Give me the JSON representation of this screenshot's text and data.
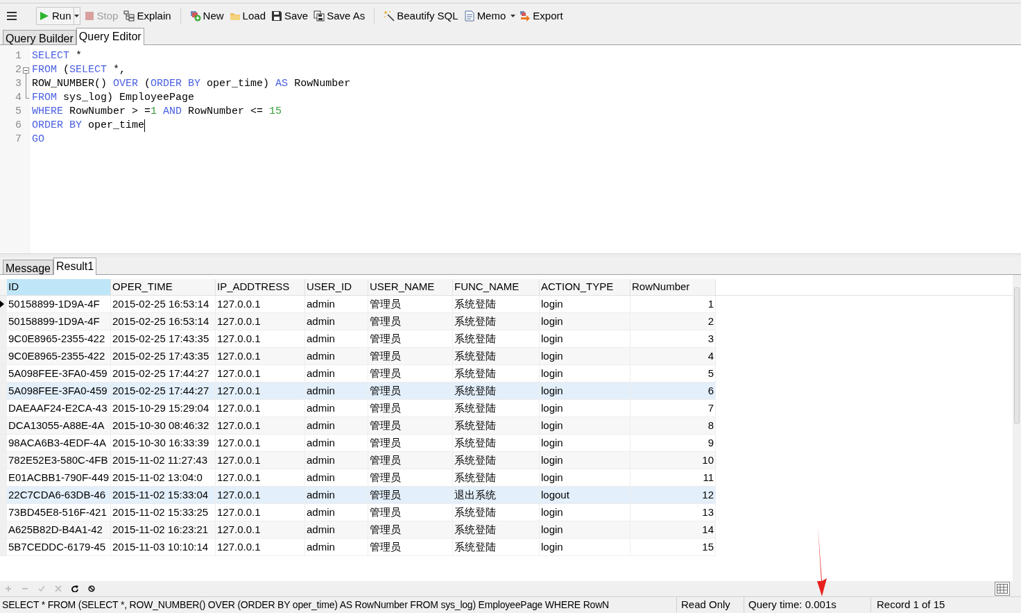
{
  "toolbar": {
    "items": [
      {
        "kind": "run",
        "label": "Run",
        "disabled": false,
        "dropdown": true
      },
      {
        "kind": "stop",
        "label": "Stop",
        "disabled": true,
        "dropdown": false
      },
      {
        "kind": "explain",
        "label": "Explain",
        "disabled": false,
        "dropdown": false
      },
      {
        "kind": "new",
        "label": "New",
        "disabled": false,
        "dropdown": false
      },
      {
        "kind": "load",
        "label": "Load",
        "disabled": false,
        "dropdown": false
      },
      {
        "kind": "save",
        "label": "Save",
        "disabled": false,
        "dropdown": false
      },
      {
        "kind": "saveas",
        "label": "Save As",
        "disabled": false,
        "dropdown": false
      },
      {
        "kind": "beautify",
        "label": "Beautify SQL",
        "disabled": false,
        "dropdown": false
      },
      {
        "kind": "memo",
        "label": "Memo",
        "disabled": false,
        "dropdown": true
      },
      {
        "kind": "export",
        "label": "Export",
        "disabled": false,
        "dropdown": false
      }
    ]
  },
  "editor_tabs": [
    {
      "label": "Query Builder",
      "selected": false
    },
    {
      "label": "Query Editor",
      "selected": true
    }
  ],
  "editor": {
    "lines": [
      {
        "number": "1",
        "kind": "plain",
        "tokens": [
          {
            "text": "SELECT",
            "kind": "keyword"
          },
          {
            "text": " *",
            "kind": "plain"
          }
        ]
      },
      {
        "number": "2",
        "kind": "fold-start",
        "tokens": [
          {
            "text": "FROM",
            "kind": "keyword"
          },
          {
            "text": " (",
            "kind": "plain"
          },
          {
            "text": "SELECT",
            "kind": "keyword"
          },
          {
            "text": " *,",
            "kind": "plain"
          }
        ]
      },
      {
        "number": "3",
        "kind": "fold-inner",
        "tokens": [
          {
            "text": "ROW_NUMBER() ",
            "kind": "plain"
          },
          {
            "text": "OVER",
            "kind": "keyword"
          },
          {
            "text": " (",
            "kind": "plain"
          },
          {
            "text": "ORDER BY",
            "kind": "keyword"
          },
          {
            "text": " oper_time) ",
            "kind": "plain"
          },
          {
            "text": "AS",
            "kind": "keyword"
          },
          {
            "text": " RowNumber",
            "kind": "plain"
          }
        ]
      },
      {
        "number": "4",
        "kind": "fold-end",
        "tokens": [
          {
            "text": "FROM",
            "kind": "keyword"
          },
          {
            "text": " sys_log) EmployeePage",
            "kind": "plain"
          }
        ]
      },
      {
        "number": "5",
        "kind": "plain",
        "tokens": [
          {
            "text": "WHERE",
            "kind": "keyword"
          },
          {
            "text": " RowNumber > =",
            "kind": "plain"
          },
          {
            "text": "1",
            "kind": "number"
          },
          {
            "text": " AND",
            "kind": "keyword"
          },
          {
            "text": " RowNumber <= ",
            "kind": "plain"
          },
          {
            "text": "15",
            "kind": "number"
          }
        ]
      },
      {
        "number": "6",
        "kind": "plain",
        "cursor": true,
        "tokens": [
          {
            "text": "ORDER BY",
            "kind": "keyword"
          },
          {
            "text": " oper_time",
            "kind": "plain"
          }
        ]
      },
      {
        "number": "7",
        "kind": "plain",
        "tokens": [
          {
            "text": "GO",
            "kind": "keyword"
          }
        ]
      }
    ]
  },
  "result_tabs": [
    {
      "label": "Message",
      "selected": false
    },
    {
      "label": "Result1",
      "selected": true
    }
  ],
  "table": {
    "columns": [
      {
        "label": "ID",
        "selected": true
      },
      {
        "label": "OPER_TIME",
        "selected": false
      },
      {
        "label": "IP_ADDTRESS",
        "selected": false
      },
      {
        "label": "USER_ID",
        "selected": false
      },
      {
        "label": "USER_NAME",
        "selected": false
      },
      {
        "label": "FUNC_NAME",
        "selected": false
      },
      {
        "label": "ACTION_TYPE",
        "selected": false
      },
      {
        "label": "RowNumber",
        "selected": false
      }
    ],
    "rows": [
      {
        "selected": true,
        "highlighted": false,
        "cells": [
          "50158899-1D9A-4F",
          "2015-02-25 16:53:14",
          "127.0.0.1",
          "admin",
          "管理员",
          "系统登陆",
          "login",
          "1"
        ]
      },
      {
        "selected": false,
        "highlighted": false,
        "cells": [
          "50158899-1D9A-4F",
          "2015-02-25 16:53:14",
          "127.0.0.1",
          "admin",
          "管理员",
          "系统登陆",
          "login",
          "2"
        ]
      },
      {
        "selected": false,
        "highlighted": false,
        "cells": [
          "9C0E8965-2355-422",
          "2015-02-25 17:43:35",
          "127.0.0.1",
          "admin",
          "管理员",
          "系统登陆",
          "login",
          "3"
        ]
      },
      {
        "selected": false,
        "highlighted": false,
        "cells": [
          "9C0E8965-2355-422",
          "2015-02-25 17:43:35",
          "127.0.0.1",
          "admin",
          "管理员",
          "系统登陆",
          "login",
          "4"
        ]
      },
      {
        "selected": false,
        "highlighted": false,
        "cells": [
          "5A098FEE-3FA0-459",
          "2015-02-25 17:44:27",
          "127.0.0.1",
          "admin",
          "管理员",
          "系统登陆",
          "login",
          "5"
        ]
      },
      {
        "selected": false,
        "highlighted": true,
        "cells": [
          "5A098FEE-3FA0-459",
          "2015-02-25 17:44:27",
          "127.0.0.1",
          "admin",
          "管理员",
          "系统登陆",
          "login",
          "6"
        ]
      },
      {
        "selected": false,
        "highlighted": false,
        "cells": [
          "DAEAAF24-E2CA-43",
          "2015-10-29 15:29:04",
          "127.0.0.1",
          "admin",
          "管理员",
          "系统登陆",
          "login",
          "7"
        ]
      },
      {
        "selected": false,
        "highlighted": false,
        "cells": [
          "DCA13055-A88E-4A",
          "2015-10-30 08:46:32",
          "127.0.0.1",
          "admin",
          "管理员",
          "系统登陆",
          "login",
          "8"
        ]
      },
      {
        "selected": false,
        "highlighted": false,
        "cells": [
          "98ACA6B3-4EDF-4A",
          "2015-10-30 16:33:39",
          "127.0.0.1",
          "admin",
          "管理员",
          "系统登陆",
          "login",
          "9"
        ]
      },
      {
        "selected": false,
        "highlighted": false,
        "cells": [
          "782E52E3-580C-4FB",
          "2015-11-02 11:27:43",
          "127.0.0.1",
          "admin",
          "管理员",
          "系统登陆",
          "login",
          "10"
        ]
      },
      {
        "selected": false,
        "highlighted": false,
        "cells": [
          "E01ACBB1-790F-449",
          "2015-11-02 13:04:0",
          "127.0.0.1",
          "admin",
          "管理员",
          "系统登陆",
          "login",
          "11"
        ]
      },
      {
        "selected": false,
        "highlighted": true,
        "cells": [
          "22C7CDA6-63DB-46",
          "2015-11-02 15:33:04",
          "127.0.0.1",
          "admin",
          "管理员",
          "退出系统",
          "logout",
          "12"
        ]
      },
      {
        "selected": false,
        "highlighted": false,
        "cells": [
          "73BD45E8-516F-421",
          "2015-11-02 15:33:25",
          "127.0.0.1",
          "admin",
          "管理员",
          "系统登陆",
          "login",
          "13"
        ]
      },
      {
        "selected": false,
        "highlighted": false,
        "cells": [
          "A625B82D-B4A1-42",
          "2015-11-02 16:23:21",
          "127.0.0.1",
          "admin",
          "管理员",
          "系统登陆",
          "login",
          "14"
        ]
      },
      {
        "selected": false,
        "highlighted": false,
        "cells": [
          "5B7CEDDC-6179-45",
          "2015-11-03 10:10:14",
          "127.0.0.1",
          "admin",
          "管理员",
          "系统登陆",
          "login",
          "15"
        ]
      }
    ]
  },
  "grid_toolbar": [
    {
      "kind": "add",
      "disabled": true
    },
    {
      "kind": "remove",
      "disabled": true
    },
    {
      "kind": "apply",
      "disabled": true
    },
    {
      "kind": "cancel",
      "disabled": true
    },
    {
      "kind": "refresh",
      "disabled": false
    },
    {
      "kind": "stop",
      "disabled": false
    }
  ],
  "status_bar": {
    "sql": "SELECT * FROM (SELECT *, ROW_NUMBER() OVER (ORDER BY oper_time) AS RowNumber FROM sys_log) EmployeePage WHERE RowN",
    "mode": "Read Only",
    "query_time": "Query time: 0.001s",
    "record": "Record 1 of 15"
  }
}
